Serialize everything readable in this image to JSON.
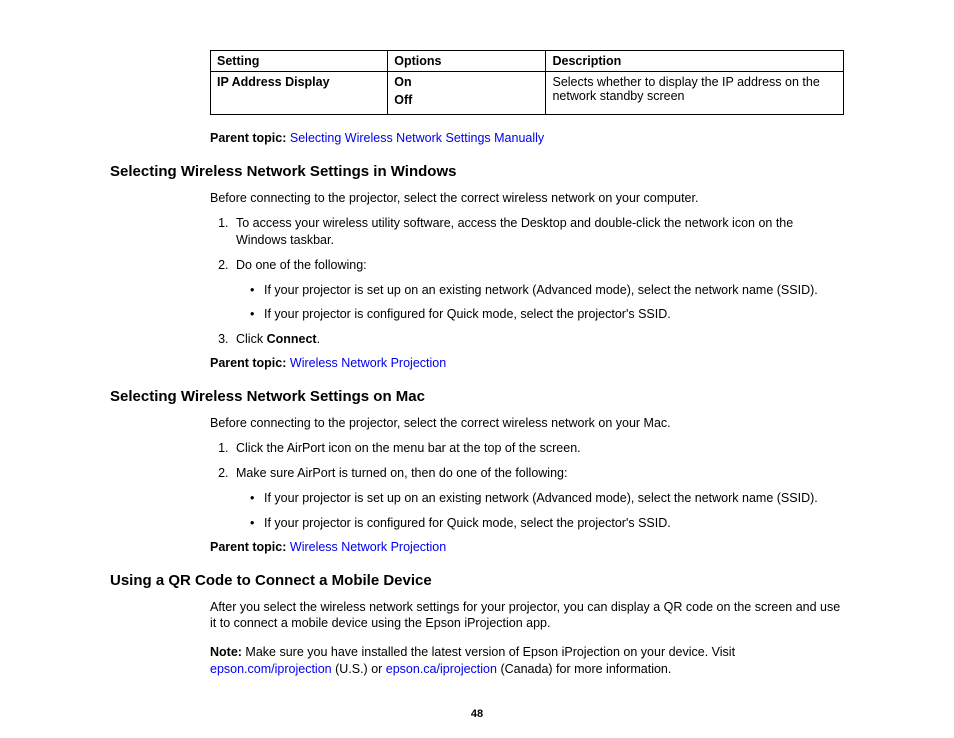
{
  "table": {
    "headers": [
      "Setting",
      "Options",
      "Description"
    ],
    "row": {
      "setting": "IP Address Display",
      "opt1": "On",
      "opt2": "Off",
      "desc": "Selects whether to display the IP address on the network standby screen"
    }
  },
  "pt_label": "Parent topic:",
  "sec1": {
    "parent_link": "Selecting Wireless Network Settings Manually",
    "heading": "Selecting Wireless Network Settings in Windows",
    "intro": "Before connecting to the projector, select the correct wireless network on your computer.",
    "li1": "To access your wireless utility software, access the Desktop and double-click the network icon on the Windows taskbar.",
    "li2": "Do one of the following:",
    "sub1": "If your projector is set up on an existing network (Advanced mode), select the network name (SSID).",
    "sub2": "If your projector is configured for Quick mode, select the projector's SSID.",
    "li3a": "Click ",
    "li3b": "Connect",
    "li3c": ".",
    "parent_link2": "Wireless Network Projection"
  },
  "sec2": {
    "heading": "Selecting Wireless Network Settings on Mac",
    "intro": "Before connecting to the projector, select the correct wireless network on your Mac.",
    "li1": "Click the AirPort icon on the menu bar at the top of the screen.",
    "li2": "Make sure AirPort is turned on, then do one of the following:",
    "sub1": "If your projector is set up on an existing network (Advanced mode), select the network name (SSID).",
    "sub2": "If your projector is configured for Quick mode, select the projector's SSID.",
    "parent_link": "Wireless Network Projection"
  },
  "sec3": {
    "heading": "Using a QR Code to Connect a Mobile Device",
    "intro": "After you select the wireless network settings for your projector, you can display a QR code on the screen and use it to connect a mobile device using the Epson iProjection app.",
    "note_label": "Note:",
    "note_a": " Make sure you have installed the latest version of Epson iProjection on your device. Visit ",
    "link1": "epson.com/iprojection",
    "note_b": " (U.S.) or ",
    "link2": "epson.ca/iprojection",
    "note_c": " (Canada) for more information."
  },
  "page": "48"
}
